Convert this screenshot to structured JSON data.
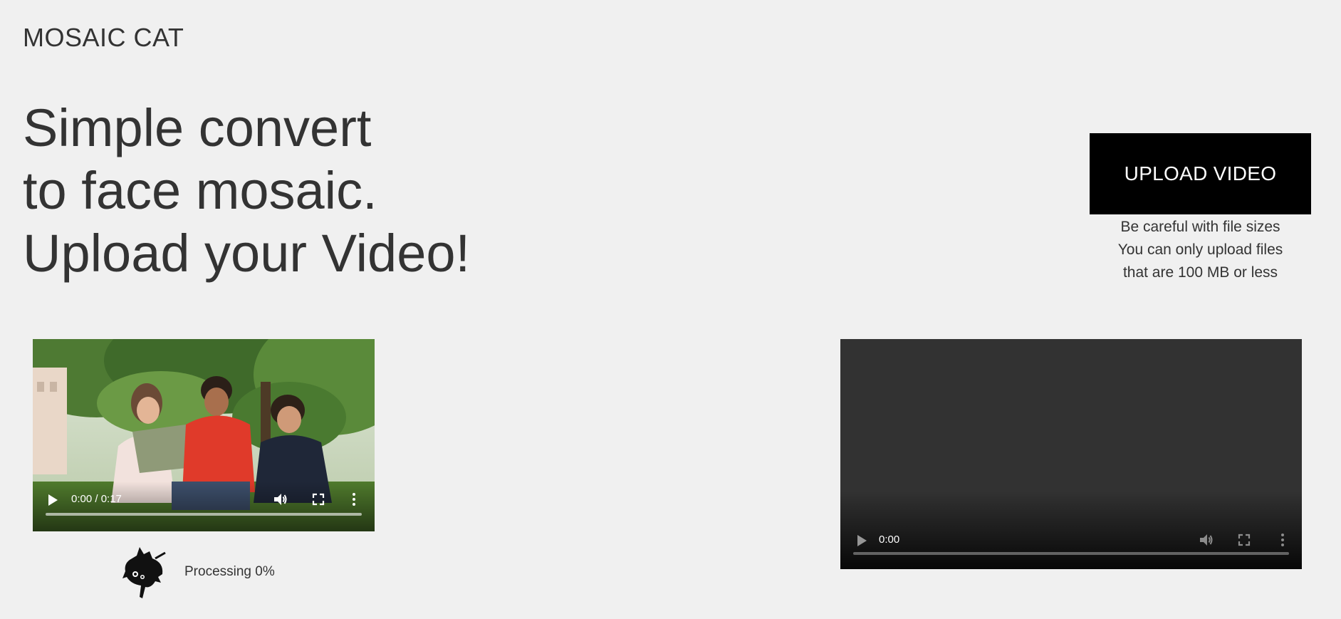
{
  "brand": "MOSAIC CAT",
  "hero": {
    "line1": "Simple convert",
    "line2": "to face mosaic.",
    "line3": "Upload your Video!"
  },
  "upload": {
    "button_label": "UPLOAD VIDEO",
    "notice_line1": "Be careful with file sizes",
    "notice_line2": "You can only upload files",
    "notice_line3": "that are 100 MB or less"
  },
  "source_video": {
    "time": "0:00 / 0:17",
    "icons": [
      "play-icon",
      "volume-icon",
      "fullscreen-icon",
      "more-options-icon"
    ]
  },
  "result_video": {
    "time": "0:00",
    "icons": [
      "play-icon",
      "volume-icon",
      "fullscreen-icon",
      "more-options-icon"
    ]
  },
  "status": {
    "text": "Processing 0%",
    "icon": "cat-icon"
  },
  "colors": {
    "background": "#f0f0f0",
    "text": "#333333",
    "button": "#000000",
    "button_text": "#ffffff",
    "empty_video": "#323232"
  }
}
